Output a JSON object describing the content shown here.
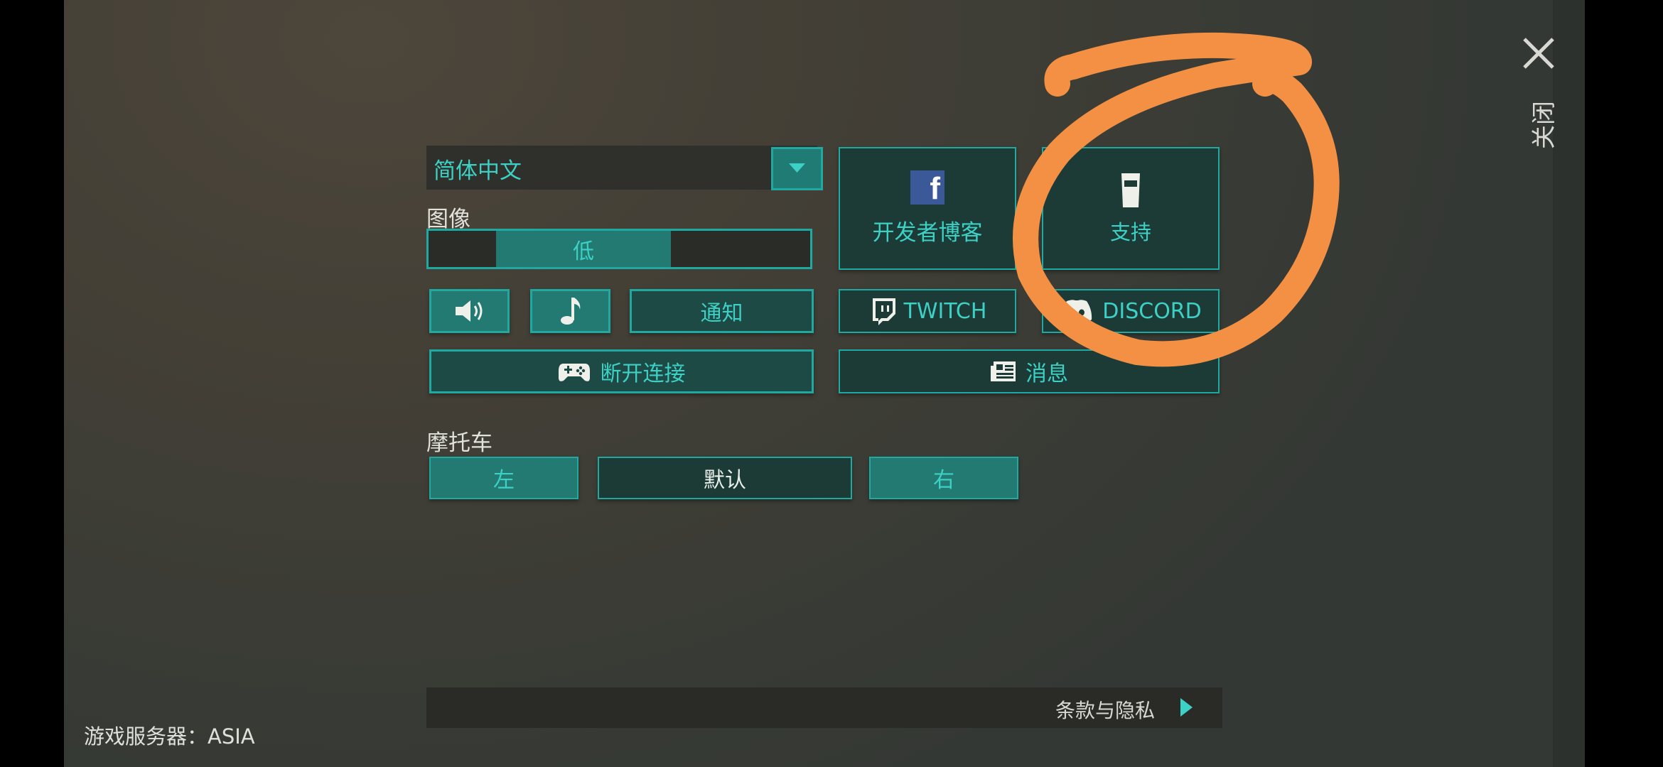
{
  "language": {
    "selected": "简体中文"
  },
  "graphics": {
    "label": "图像",
    "level": "低",
    "level_fraction": 0.33
  },
  "audio": {
    "sound_icon": "speaker-icon",
    "music_icon": "music-note-icon",
    "notify_label": "通知"
  },
  "disconnect": {
    "label": "断开连接",
    "icon": "gamepad-icon"
  },
  "social": {
    "facebook_label": "开发者博客",
    "support_label": "支持",
    "twitch_label": "TWITCH",
    "discord_label": "DISCORD",
    "news_label": "消息"
  },
  "motorcycle": {
    "label": "摩托车",
    "left": "左",
    "default": "默认",
    "right": "右"
  },
  "terms": {
    "label": "条款与隐私"
  },
  "server": {
    "label": "游戏服务器：ASIA"
  },
  "close": {
    "label": "关闭"
  },
  "colors": {
    "accent": "#20a9a0",
    "text_accent": "#3dd1c6",
    "annotation": "#f39044"
  }
}
